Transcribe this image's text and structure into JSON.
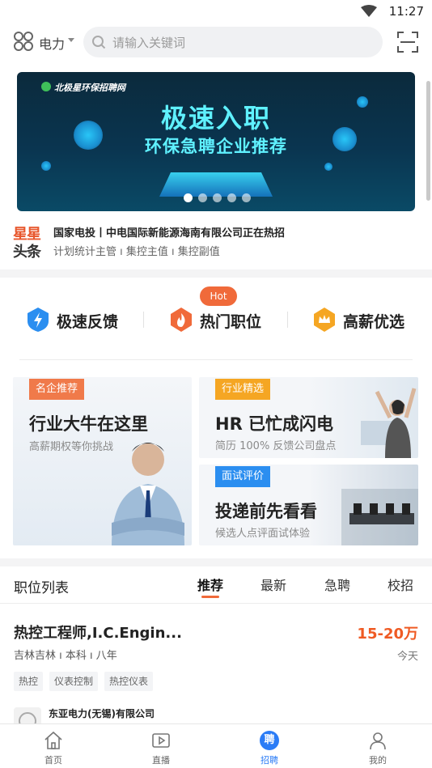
{
  "status_bar": {
    "time": "11:27"
  },
  "topbar": {
    "category": "电力",
    "search_placeholder": "请输入关键词"
  },
  "banner": {
    "logo": "北极星环保招聘网",
    "headline": "极速入职",
    "subheadline": "环保急聘企业推荐",
    "total_slides": 5,
    "active_slide": 1
  },
  "headline_news": {
    "logo_line1": "星星",
    "logo_line2": "头条",
    "title": "国家电投丨中电国际新能源海南有限公司正在热招",
    "subtitle": "计划统计主管 ı 集控主值 ı 集控副值"
  },
  "quick_actions": [
    {
      "label": "极速反馈",
      "icon": "lightning-shield-icon",
      "color": "#2b8ef0"
    },
    {
      "label": "热门职位",
      "icon": "flame-icon",
      "color": "#f06a3a",
      "badge": "Hot"
    },
    {
      "label": "高薪优选",
      "icon": "crown-icon",
      "color": "#f5a623"
    }
  ],
  "feature_cards": {
    "left": {
      "tag": "名企推荐",
      "title": "行业大牛在这里",
      "subtitle": "高薪期权等你挑战",
      "tag_color": "#f07a4a"
    },
    "right_top": {
      "tag": "行业精选",
      "title": "HR 已忙成闪电",
      "subtitle": "简历 100% 反馈公司盘点",
      "tag_color": "#f5a623"
    },
    "right_bottom": {
      "tag": "面试评价",
      "title": "投递前先看看",
      "subtitle": "候选人点评面试体验",
      "tag_color": "#2b8ef0"
    }
  },
  "job_list": {
    "title": "职位列表",
    "tabs": [
      "推荐",
      "最新",
      "急聘",
      "校招"
    ],
    "active_tab": "推荐",
    "jobs": [
      {
        "name": "热控工程师,I.C.Engin...",
        "salary": "15-20万",
        "meta": "吉林吉林 ı 本科 ı 八年",
        "date": "今天",
        "tags": [
          "热控",
          "仪表控制",
          "热控仪表"
        ],
        "company": "东亚电力(无锡)有限公司"
      }
    ]
  },
  "tabbar": {
    "items": [
      {
        "label": "首页",
        "icon": "home-icon"
      },
      {
        "label": "直播",
        "icon": "live-video-icon"
      },
      {
        "label": "招聘",
        "icon": "recruit-icon",
        "icon_text": "聘"
      },
      {
        "label": "我的",
        "icon": "profile-icon"
      }
    ],
    "active": "招聘",
    "accent": "#2b7cf6"
  }
}
